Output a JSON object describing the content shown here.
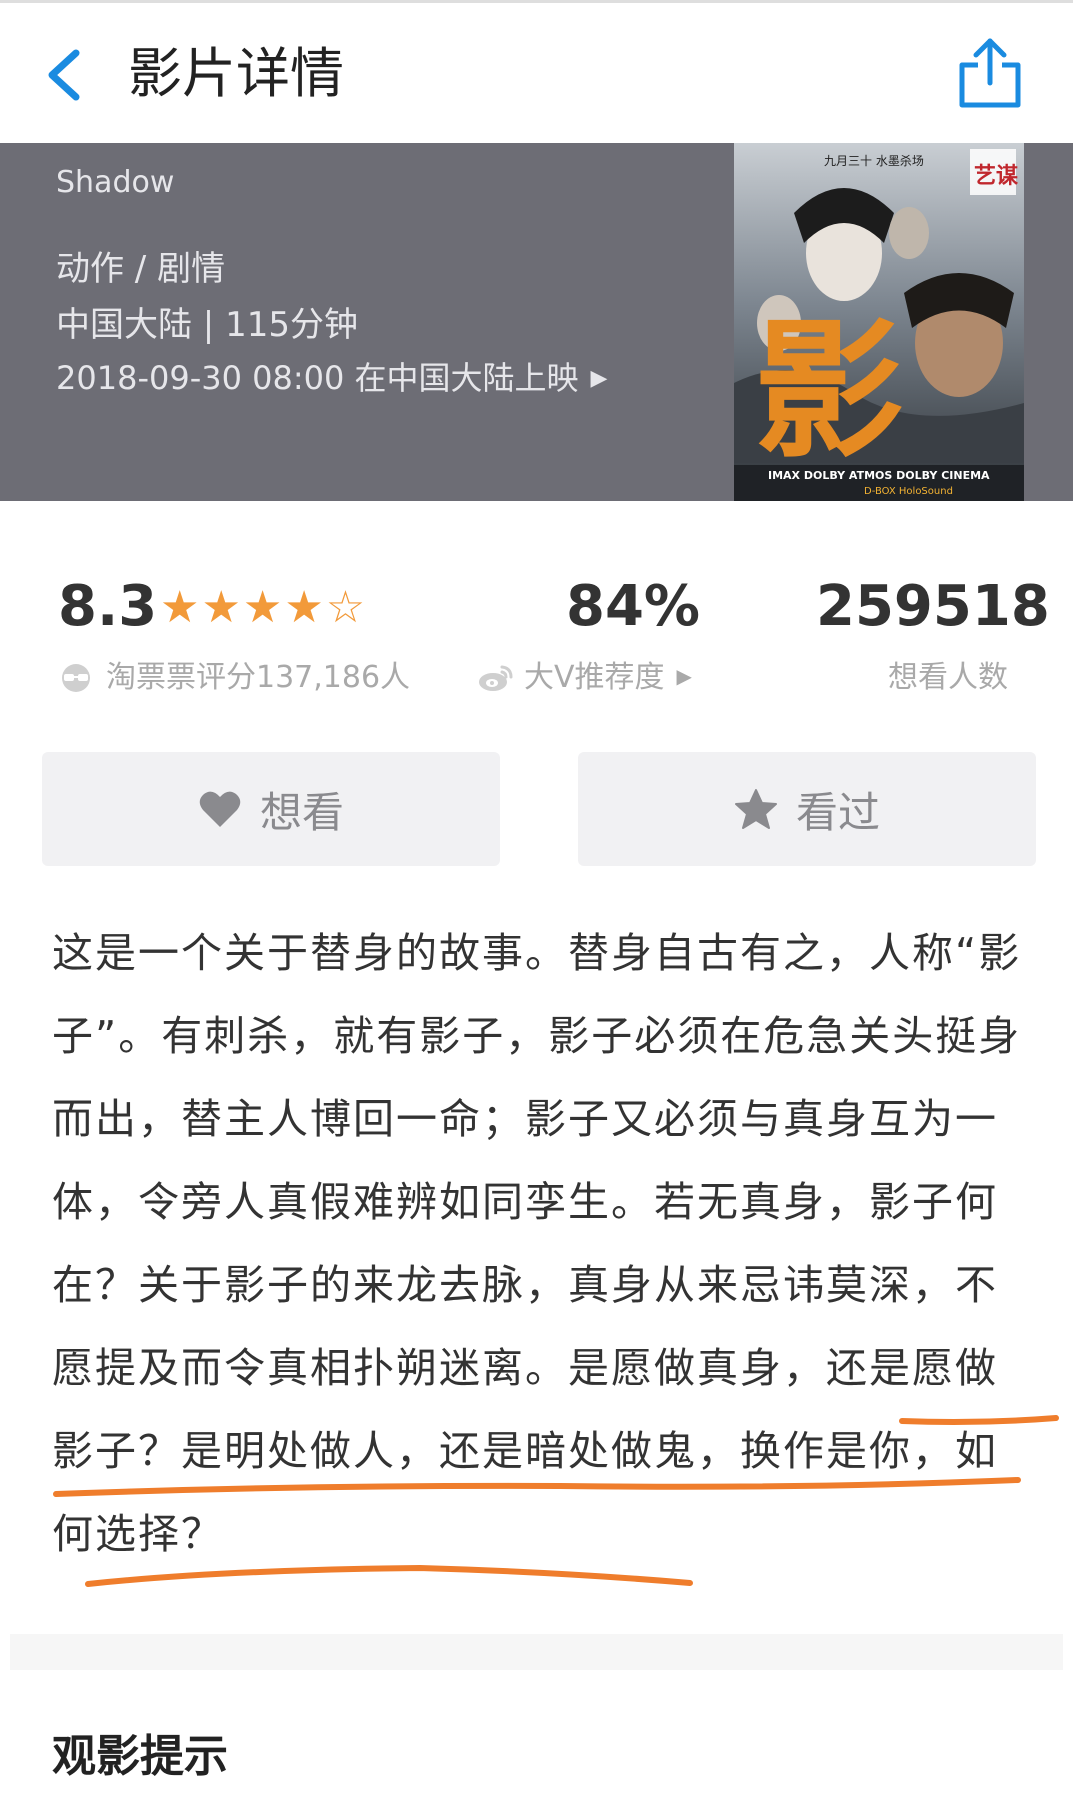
{
  "nav": {
    "title": "影片详情"
  },
  "movie": {
    "english_title": "Shadow",
    "genre": "动作 / 剧情",
    "region_duration": "中国大陆 | 115分钟",
    "release": "2018-09-30 08:00 在中国大陆上映",
    "poster": {
      "big_char": "影",
      "tag": "艺谋",
      "top_text": "九月三十 水墨杀场",
      "formats": "IMAX  DOLBY ATMOS  DOLBY CINEMA",
      "formats2": "D-BOX  HoloSound"
    }
  },
  "rating": {
    "score": "8.3",
    "stars": "★★★★☆",
    "score_label": "淘票票评分137,186人",
    "recommend": "84%",
    "recommend_label": "大V推荐度",
    "want_count": "259518",
    "want_label": "想看人数"
  },
  "buttons": {
    "want": "想看",
    "seen": "看过"
  },
  "synopsis": "这是一个关于替身的故事。替身自古有之，人称“影子”。有刺杀，就有影子，影子必须在危急关头挺身而出，替主人博回一命；影子又必须与真身互为一体，令旁人真假难辨如同孪生。若无真身，影子何在？关于影子的来龙去脉，真身从来忌讳莫深，不愿提及而令真相扑朔迷离。是愿做真身，还是愿做影子？是明处做人，还是暗处做鬼，换作是你，如何选择？",
  "section": {
    "tips_title": "观影提示"
  },
  "colors": {
    "accent_blue": "#1a8be0",
    "star_orange": "#f29a3a",
    "underline_orange": "#ef7d2c",
    "hero_bg": "#6d6d75"
  }
}
